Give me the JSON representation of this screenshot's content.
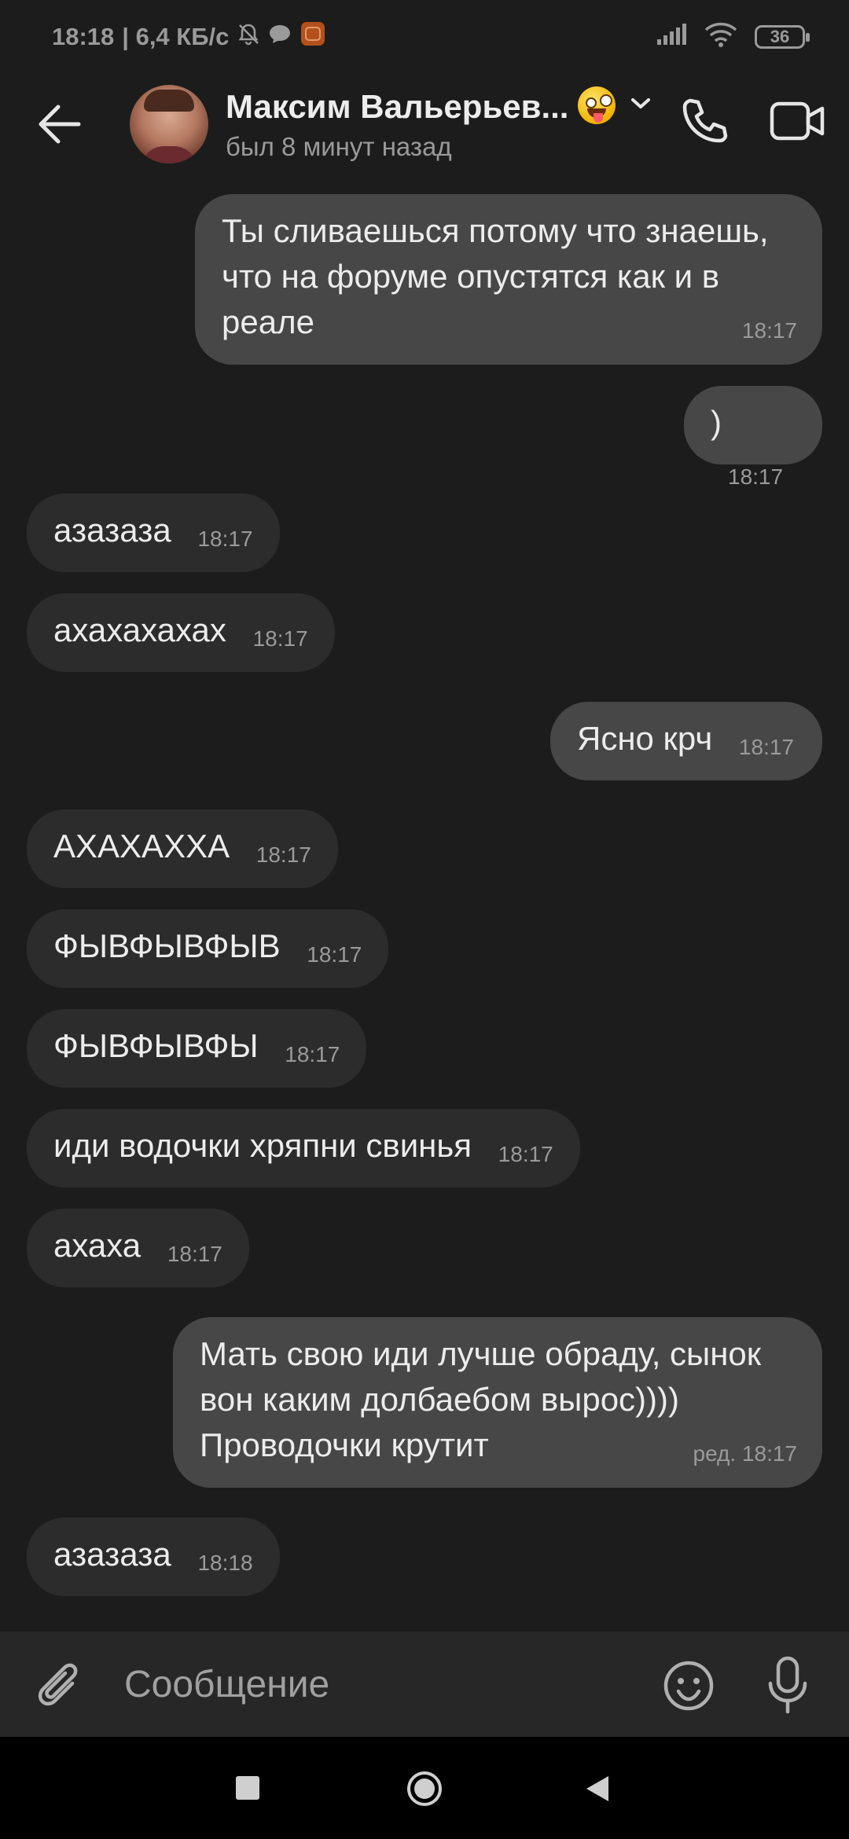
{
  "statusbar": {
    "time": "18:18",
    "netspeed": "| 6,4 КБ/с",
    "battery": "36"
  },
  "header": {
    "contact_name": "Максим Вальерьев...",
    "status": "был 8 минут назад"
  },
  "messages": [
    {
      "dir": "out",
      "text": "Ты сливаешься потому что знаешь, что на форуме опустятся как и в реале",
      "time": "18:17"
    },
    {
      "dir": "out",
      "text": ")",
      "time": "18:17"
    },
    {
      "dir": "in",
      "text": "азазаза",
      "time": "18:17"
    },
    {
      "dir": "in",
      "text": "ахахахахах",
      "time": "18:17"
    },
    {
      "dir": "out",
      "text": "Ясно крч",
      "time": "18:17"
    },
    {
      "dir": "in",
      "text": "АХАХАХХА",
      "time": "18:17"
    },
    {
      "dir": "in",
      "text": "ФЫВФЫВФЫВ",
      "time": "18:17"
    },
    {
      "dir": "in",
      "text": "ФЫВФЫВФЫ",
      "time": "18:17"
    },
    {
      "dir": "in",
      "text": "иди водочки хряпни свинья",
      "time": "18:17"
    },
    {
      "dir": "in",
      "text": "ахаха",
      "time": "18:17"
    },
    {
      "dir": "out",
      "text": "Мать свою иди лучше обраду, сынок вон каким долбаебом вырос)))) Проводочки крутит",
      "time": "ред. 18:17"
    },
    {
      "dir": "in",
      "text": "азазаза",
      "time": "18:18"
    }
  ],
  "composer": {
    "placeholder": "Сообщение"
  },
  "colors": {
    "background": "#1c1c1c",
    "outgoing_bubble": "#474747",
    "incoming_bubble": "#2c2c2c",
    "secondary_text": "#9a9a9a"
  },
  "icons": [
    "back-arrow-icon",
    "chevron-down-icon",
    "phone-icon",
    "video-camera-icon",
    "paperclip-icon",
    "smiley-icon",
    "microphone-icon",
    "silent-bell-icon",
    "chat-bubble-icon",
    "signal-icon",
    "wifi-icon",
    "battery-icon"
  ]
}
